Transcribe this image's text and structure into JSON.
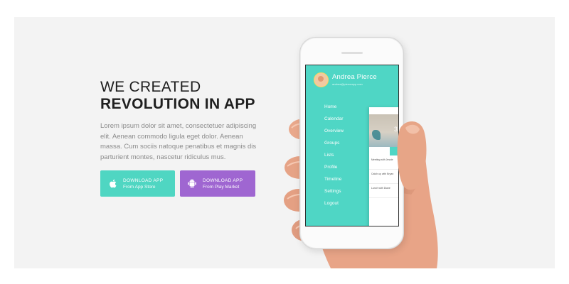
{
  "hero": {
    "headline_line1": "WE CREATED",
    "headline_line2": "REVOLUTION IN APP",
    "description": "Lorem ipsum dolor sit amet, consectetuer adipiscing elit. Aenean commodo ligula eget dolor. Aenean massa. Cum sociis natoque penatibus et magnis dis parturient montes, nascetur ridiculus mus."
  },
  "buttons": {
    "app_store": {
      "title": "DOWNLOAD APP",
      "subtitle": "From App Store",
      "icon": "apple-icon",
      "color": "#4fd6c2"
    },
    "play_market": {
      "title": "DOWNLOAD APP",
      "subtitle": "From Play Market",
      "icon": "android-icon",
      "color": "#9f66d1"
    }
  },
  "phone_app": {
    "profile_name": "Andrea Pierce",
    "profile_email": "andrea@pierceapp.com",
    "menu": [
      {
        "label": "Home"
      },
      {
        "label": "Calendar"
      },
      {
        "label": "Overview"
      },
      {
        "label": "Groups"
      },
      {
        "label": "Lists"
      },
      {
        "label": "Profile"
      },
      {
        "label": "Timeline"
      },
      {
        "label": "Settings"
      },
      {
        "label": "Logout"
      }
    ],
    "panel": {
      "photo_number": "3",
      "events": [
        {
          "title": "Meeting with Jessie"
        },
        {
          "title": "Catch up with Bryan"
        },
        {
          "title": "Lunch with Diane"
        }
      ]
    },
    "accent_color": "#4fd6c5"
  }
}
